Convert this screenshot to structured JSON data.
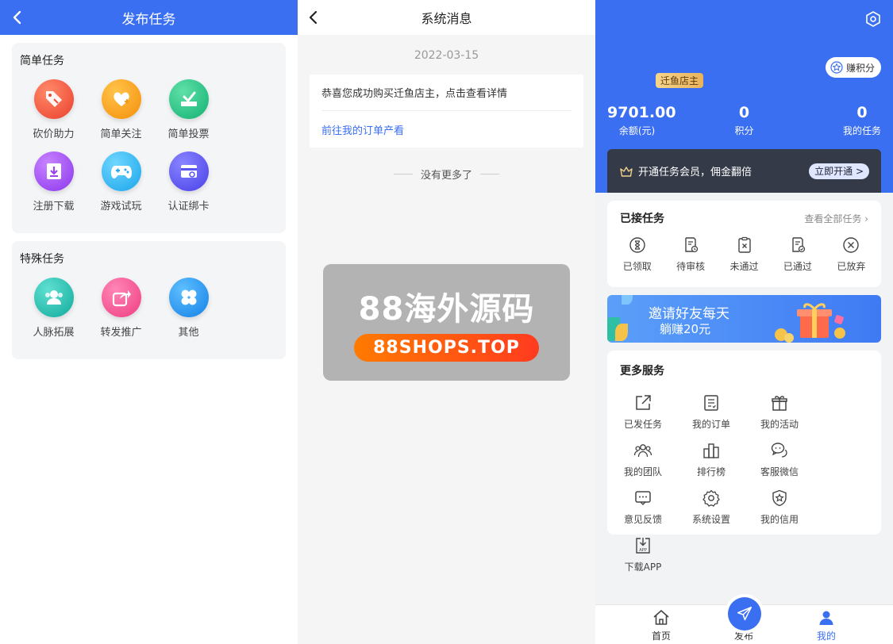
{
  "colors": {
    "primary": "#3a6ff2",
    "vip_bg": "#353a48",
    "badge": "#e9b25a"
  },
  "publish": {
    "title": "发布任务",
    "simple": {
      "title": "简单任务",
      "items": [
        {
          "label": "砍价助力",
          "icon": "tag-icon",
          "color": "#f0573f"
        },
        {
          "label": "简单关注",
          "icon": "heart-plus-icon",
          "color": "#f7a11a"
        },
        {
          "label": "简单投票",
          "icon": "vote-box-icon",
          "color": "#22c185"
        },
        {
          "label": "注册下载",
          "icon": "download-icon",
          "color": "#a14df2"
        },
        {
          "label": "游戏试玩",
          "icon": "gamepad-icon",
          "color": "#28b6f0"
        },
        {
          "label": "认证绑卡",
          "icon": "card-link-icon",
          "color": "#5b55f0"
        }
      ]
    },
    "special": {
      "title": "特殊任务",
      "items": [
        {
          "label": "人脉拓展",
          "icon": "people-icon",
          "color": "#1cc0b0"
        },
        {
          "label": "转发推广",
          "icon": "share-icon",
          "color": "#f4508f"
        },
        {
          "label": "其他",
          "icon": "clover-icon",
          "color": "#2196f3"
        }
      ]
    }
  },
  "messages": {
    "title": "系统消息",
    "date": "2022-03-15",
    "text": "恭喜您成功购买迁鱼店主，点击查看详情",
    "link": "前往我的订单产看",
    "no_more": "没有更多了",
    "watermark_title": "88海外源码",
    "watermark_url": "88SHOPS.TOP"
  },
  "profile": {
    "earn_points": "赚积分",
    "level_badge": "迁鱼店主",
    "stats": [
      {
        "value": "9701.00",
        "label": "余额(元)"
      },
      {
        "value": "0",
        "label": "积分"
      },
      {
        "value": "0",
        "label": "我的任务"
      }
    ],
    "vip_text": "开通任务会员，佣金翻倍",
    "vip_button": "立即开通 >",
    "accepted": {
      "title": "已接任务",
      "view_all": "查看全部任务",
      "items": [
        {
          "label": "已领取",
          "icon": "hourglass-icon"
        },
        {
          "label": "待审核",
          "icon": "doc-clock-icon"
        },
        {
          "label": "未通过",
          "icon": "clipboard-x-icon"
        },
        {
          "label": "已通过",
          "icon": "doc-check-icon"
        },
        {
          "label": "已放弃",
          "icon": "circle-x-icon"
        }
      ]
    },
    "banner_line1": "邀请好友每天",
    "banner_line2": "躺赚20元",
    "services": {
      "title": "更多服务",
      "items": [
        {
          "label": "已发任务",
          "icon": "external-link-icon"
        },
        {
          "label": "我的订单",
          "icon": "order-list-icon"
        },
        {
          "label": "我的活动",
          "icon": "gift-icon"
        },
        {
          "label": "我的团队",
          "icon": "team-icon"
        },
        {
          "label": "排行榜",
          "icon": "ranking-icon"
        },
        {
          "label": "客服微信",
          "icon": "chat-bubbles-icon"
        },
        {
          "label": "意见反馈",
          "icon": "feedback-icon"
        },
        {
          "label": "系统设置",
          "icon": "settings-icon"
        },
        {
          "label": "我的信用",
          "icon": "shield-star-icon"
        },
        {
          "label": "下载APP",
          "icon": "app-download-icon"
        }
      ]
    },
    "tabs": [
      {
        "label": "首页",
        "icon": "home-icon"
      },
      {
        "label": "发布",
        "icon": "send-icon"
      },
      {
        "label": "我的",
        "icon": "user-icon"
      }
    ]
  }
}
